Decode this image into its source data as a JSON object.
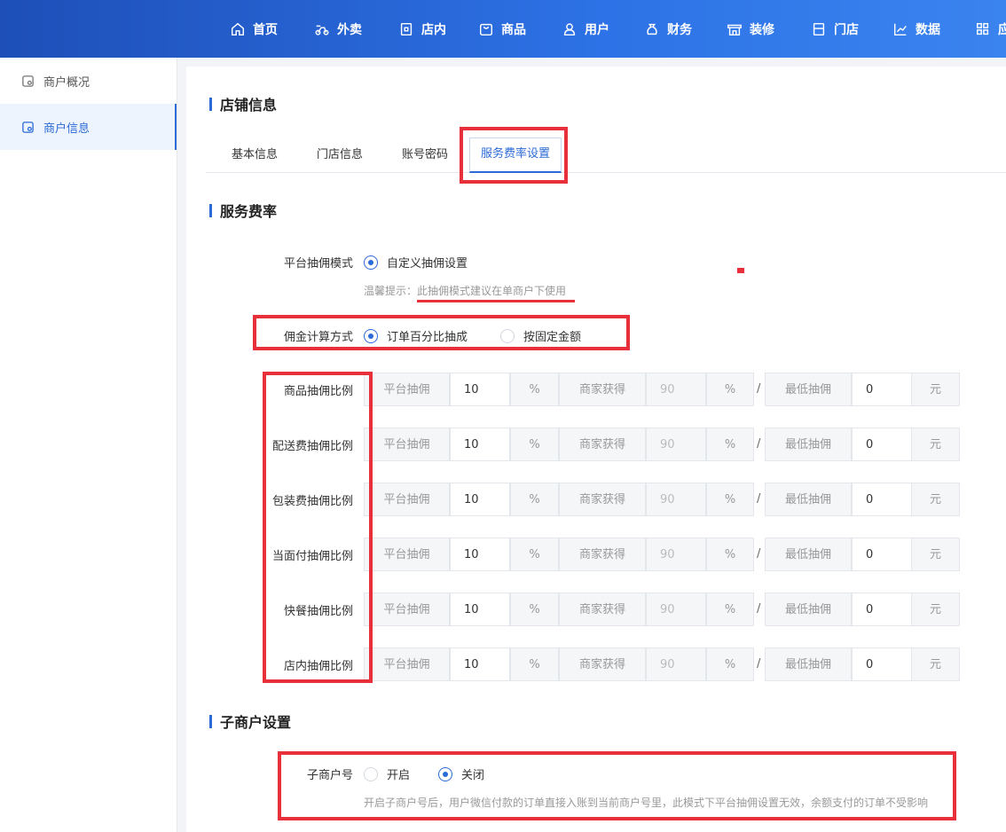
{
  "nav": {
    "items": [
      {
        "label": "首页",
        "icon": "home-icon"
      },
      {
        "label": "外卖",
        "icon": "scooter-icon"
      },
      {
        "label": "店内",
        "icon": "qrcode-icon"
      },
      {
        "label": "商品",
        "icon": "bag-icon"
      },
      {
        "label": "用户",
        "icon": "user-icon"
      },
      {
        "label": "财务",
        "icon": "money-bag-icon"
      },
      {
        "label": "装修",
        "icon": "store-decor-icon"
      },
      {
        "label": "门店",
        "icon": "shop-icon"
      },
      {
        "label": "数据",
        "icon": "chart-icon"
      },
      {
        "label": "应",
        "icon": "apps-icon"
      }
    ]
  },
  "sidebar": {
    "items": [
      {
        "label": "商户概况"
      },
      {
        "label": "商户信息",
        "active": true
      }
    ]
  },
  "page": {
    "title": "店铺信息",
    "tabs": [
      {
        "label": "基本信息"
      },
      {
        "label": "门店信息"
      },
      {
        "label": "账号密码"
      },
      {
        "label": "服务费率设置",
        "active": true
      }
    ]
  },
  "service_rate": {
    "title": "服务费率",
    "mode_label": "平台抽佣模式",
    "mode_option": "自定义抽佣设置",
    "mode_hint_prefix": "温馨提示：",
    "mode_hint": "此抽佣模式建议在单商户下使用",
    "calc_label": "佣金计算方式",
    "calc_options": [
      {
        "label": "订单百分比抽成",
        "checked": true
      },
      {
        "label": "按固定金额",
        "checked": false
      }
    ],
    "addon_platform": "平台抽佣",
    "addon_percent": "%",
    "addon_merchant": "商家获得",
    "slash": "/",
    "addon_min": "最低抽佣",
    "addon_yuan": "元",
    "rows": [
      {
        "label": "商品抽佣比例",
        "platform": "10",
        "merchant": "90",
        "min": "0"
      },
      {
        "label": "配送费抽佣比例",
        "platform": "10",
        "merchant": "90",
        "min": "0"
      },
      {
        "label": "包装费抽佣比例",
        "platform": "10",
        "merchant": "90",
        "min": "0"
      },
      {
        "label": "当面付抽佣比例",
        "platform": "10",
        "merchant": "90",
        "min": "0"
      },
      {
        "label": "快餐抽佣比例",
        "platform": "10",
        "merchant": "90",
        "min": "0"
      },
      {
        "label": "店内抽佣比例",
        "platform": "10",
        "merchant": "90",
        "min": "0"
      }
    ]
  },
  "sub_merchant": {
    "title": "子商户设置",
    "label": "子商户号",
    "options": [
      {
        "label": "开启",
        "checked": false
      },
      {
        "label": "关闭",
        "checked": true
      }
    ],
    "hint": "开启子商户号后，用户微信付款的订单直接入账到当前商户号里，此模式下平台抽佣设置无效，余额支付的订单不受影响"
  },
  "colors": {
    "accent": "#2b6ad7",
    "nav_start": "#1e4fb8",
    "nav_end": "#3a84ef",
    "annotation": "#e8303a"
  }
}
